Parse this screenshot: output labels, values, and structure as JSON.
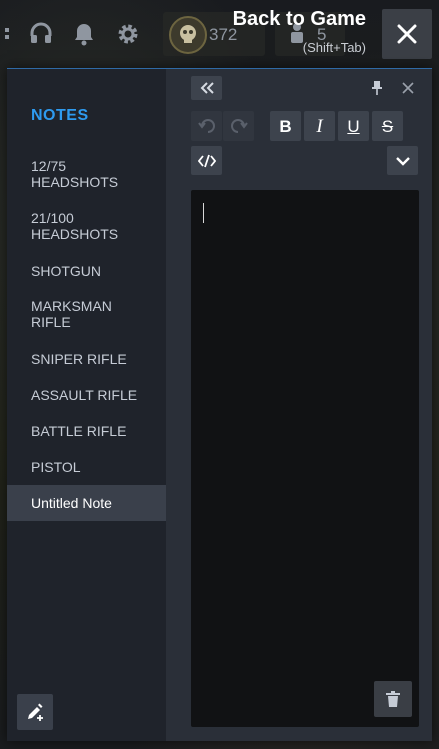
{
  "overlay": {
    "back_title": "Back to Game",
    "back_shortcut": "(Shift+Tab)",
    "counter_1": "372",
    "counter_2": "5"
  },
  "sidebar": {
    "heading": "NOTES",
    "notes": [
      {
        "title": "12/75\nHEADSHOTS"
      },
      {
        "title": "21/100\nHEADSHOTS"
      },
      {
        "title": "SHOTGUN"
      },
      {
        "title": "MARKSMAN\nRIFLE"
      },
      {
        "title": "SNIPER RIFLE"
      },
      {
        "title": "ASSAULT RIFLE"
      },
      {
        "title": "BATTLE RIFLE"
      },
      {
        "title": "PISTOL"
      },
      {
        "title": "Untitled Note",
        "active": true
      }
    ]
  },
  "toolbar": {
    "bold": "B",
    "italic": "I",
    "underline": "U",
    "strike": "S"
  },
  "editor": {
    "content": ""
  },
  "colors": {
    "accent": "#2e9bf0",
    "panel": "#2a2f38",
    "sidebar": "#1f232b",
    "editor": "#111214"
  }
}
